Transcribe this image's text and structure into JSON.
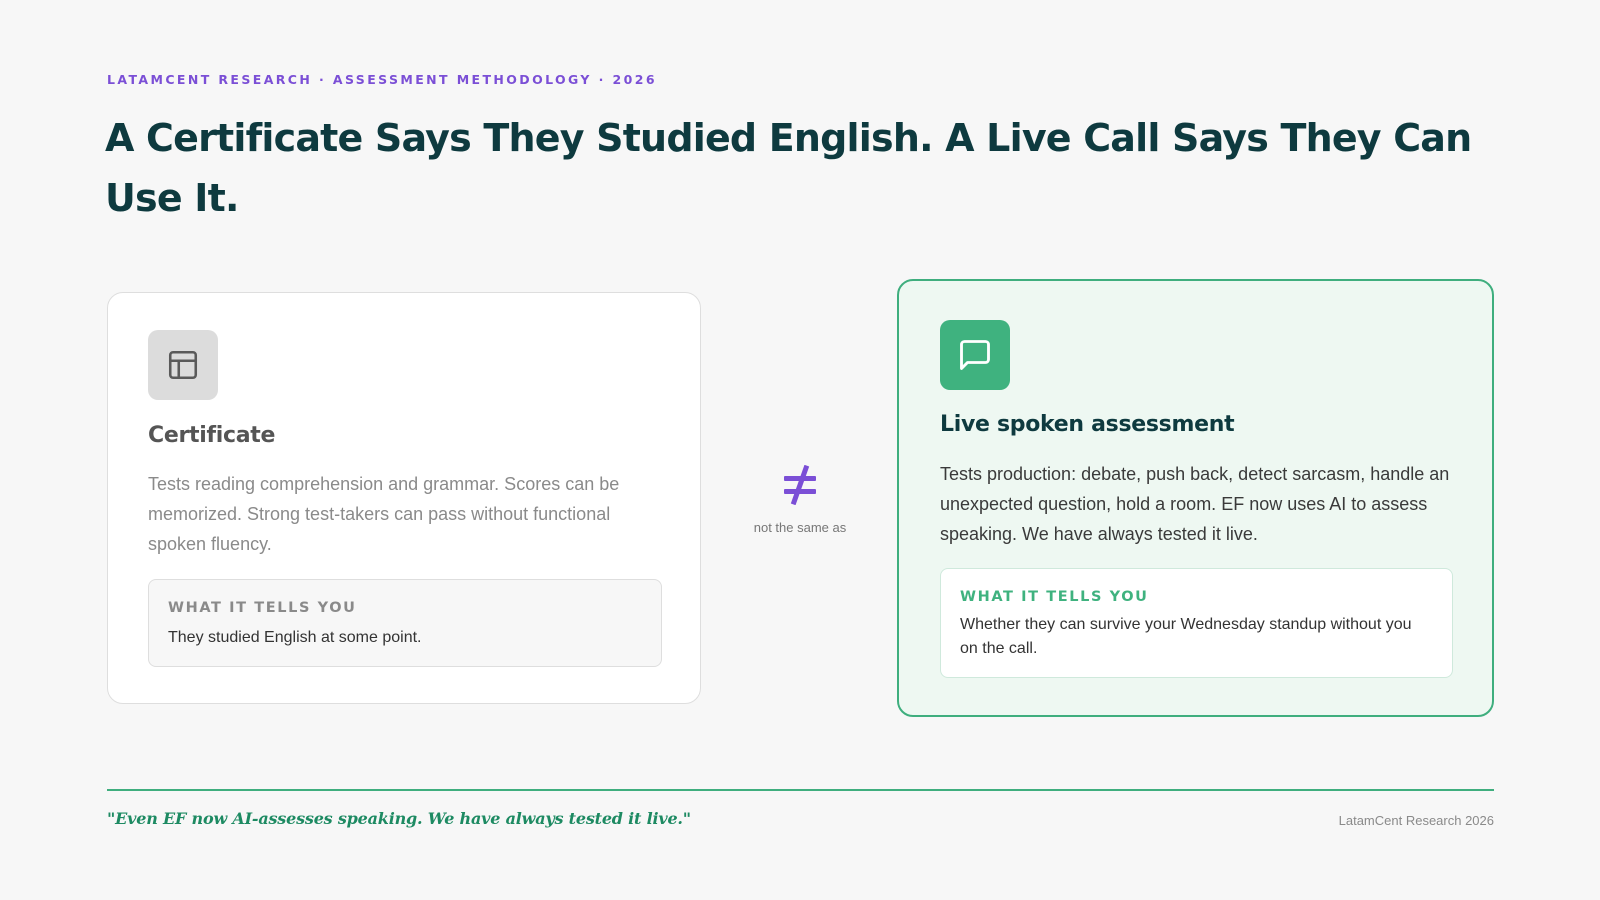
{
  "header": {
    "eyebrow": "LATAMCENT RESEARCH · ASSESSMENT METHODOLOGY · 2026",
    "title": "A Certificate Says They Studied English. A Live Call Says They Can Use It."
  },
  "comparison": {
    "left": {
      "icon": "layout-icon",
      "heading": "Certificate",
      "body": "Tests reading comprehension and grammar. Scores can be memorized. Strong test-takers can pass without functional spoken fluency.",
      "tells_label": "WHAT IT TELLS YOU",
      "tells_text": "They studied English at some point."
    },
    "separator": {
      "icon": "not-equal-icon",
      "label": "not the same as"
    },
    "right": {
      "icon": "chat-bubble-icon",
      "heading": "Live spoken assessment",
      "body": "Tests production: debate, push back, detect sarcasm, handle an unexpected question, hold a room. EF now uses AI to assess speaking. We have always tested it live.",
      "tells_label": "WHAT IT TELLS YOU",
      "tells_text": "Whether they can survive your Wednesday standup without you on the call."
    }
  },
  "footer": {
    "quote": "\"Even EF now AI-assesses speaking. We have always tested it live.\"",
    "credit": "LatamCent Research 2026"
  },
  "colors": {
    "accent_purple": "#7b4fd6",
    "title_dark": "#0e3a3f",
    "accent_green": "#3fb27f",
    "quote_green": "#1d8a62"
  }
}
